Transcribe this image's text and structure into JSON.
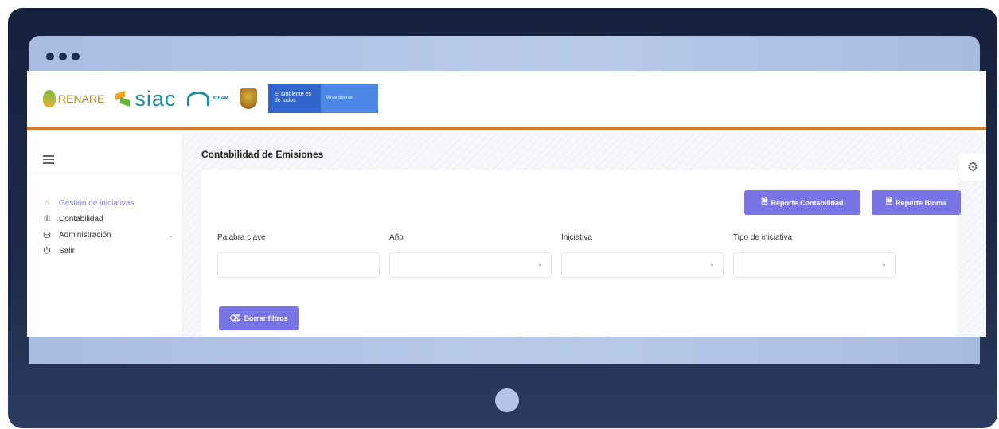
{
  "header": {
    "logos": {
      "renare": "RENARE",
      "siac": "siac",
      "ideam": "IDEAM",
      "gov_banner": "El ambiente es de todos",
      "ministry": "Minambiente"
    }
  },
  "sidebar": {
    "items": [
      {
        "label": "Gestión de iniciativas",
        "icon": "home-icon",
        "active": true
      },
      {
        "label": "Contabilidad",
        "icon": "bar-chart-icon",
        "active": false
      },
      {
        "label": "Administración",
        "icon": "database-icon",
        "active": false,
        "expandable": true
      },
      {
        "label": "Salir",
        "icon": "power-icon",
        "active": false
      }
    ]
  },
  "main": {
    "title": "Contabilidad de Emisiones",
    "buttons": {
      "reporte_contabilidad": "Reporte Contabilidad",
      "reporte_bioma": "Reporte Bioma",
      "borrar_filtros": "Borrar filtros"
    },
    "filters": {
      "keyword_label": "Palabra clave",
      "keyword_value": "",
      "year_label": "Año",
      "year_value": "",
      "initiative_label": "Iniciativa",
      "initiative_value": "",
      "type_label": "Tipo de iniciativa",
      "type_value": ""
    }
  },
  "colors": {
    "accent": "#7a75e6",
    "header_border": "#d57a2c",
    "active_nav": "#7a7ee8"
  }
}
